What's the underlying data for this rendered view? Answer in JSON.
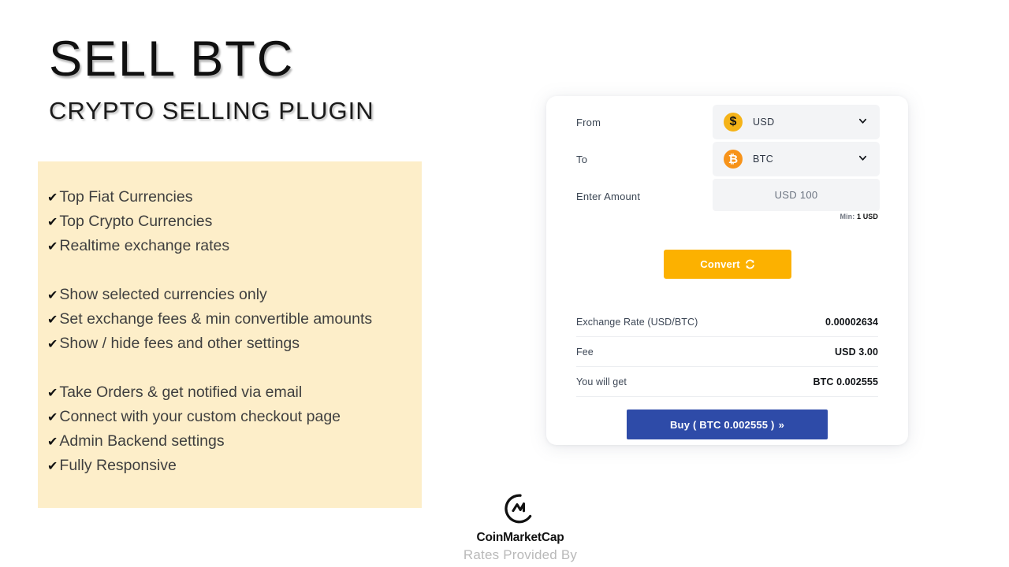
{
  "hero": {
    "title": "SELL BTC",
    "subtitle": "CRYPTO SELLING PLUGIN"
  },
  "features": {
    "check_glyph": "✔",
    "items": [
      {
        "label": "Top Fiat Currencies",
        "spacer_after": false
      },
      {
        "label": "Top Crypto Currencies",
        "spacer_after": false
      },
      {
        "label": "Realtime exchange rates",
        "spacer_after": true
      },
      {
        "label": "Show selected currencies only",
        "spacer_after": false
      },
      {
        "label": "Set exchange fees & min convertible amounts",
        "spacer_after": false
      },
      {
        "label": "Show / hide fees and other settings",
        "spacer_after": true
      },
      {
        "label": "Take Orders & get notified via email",
        "spacer_after": false
      },
      {
        "label": "Connect with your custom checkout page",
        "spacer_after": false
      },
      {
        "label": "Admin Backend settings",
        "spacer_after": false
      },
      {
        "label": "Fully Responsive",
        "spacer_after": false
      }
    ]
  },
  "converter": {
    "from": {
      "label": "From",
      "currency_code": "USD",
      "currency_symbol": "$"
    },
    "to": {
      "label": "To",
      "currency_code": "BTC",
      "currency_symbol": "₿"
    },
    "amount": {
      "label": "Enter Amount",
      "placeholder": "USD 100",
      "min_prefix": "Min:",
      "min_value": "1 USD"
    },
    "convert_button": {
      "label": "Convert"
    },
    "results": [
      {
        "label": "Exchange Rate (USD/BTC)",
        "value": "0.00002634"
      },
      {
        "label": "Fee",
        "value": "USD 3.00"
      },
      {
        "label": "You will get",
        "value": "BTC 0.002555"
      }
    ],
    "buy_button": {
      "label": "Buy ( BTC 0.002555 )",
      "arrow_glyph": "»"
    }
  },
  "attribution": {
    "brand": "CoinMarketCap",
    "tagline": "Rates Provided By"
  },
  "colors": {
    "panel_cream": "#fdeec9",
    "usd_coin": "#f5b318",
    "btc_coin": "#f7931a",
    "convert_amber": "#fcb100",
    "buy_blue": "#2e4ba8",
    "field_gray": "#f3f4f6"
  }
}
